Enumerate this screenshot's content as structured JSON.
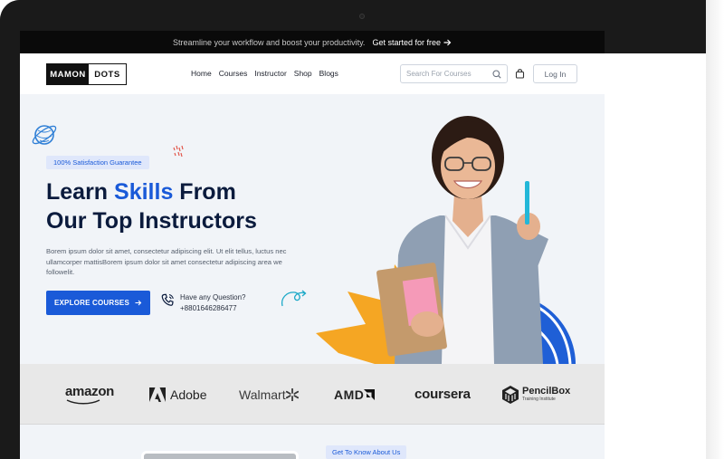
{
  "announcement": {
    "text": "Streamline your workflow and boost your productivity.",
    "cta_label": "Get started for free"
  },
  "nav": {
    "logo_part1": "MAMON",
    "logo_part2": "DOTS",
    "links": [
      "Home",
      "Courses",
      "Instructor",
      "Shop",
      "Blogs"
    ],
    "search_placeholder": "Search For Courses",
    "login_label": "Log In"
  },
  "hero": {
    "badge": "100% Satisfaction Guarantee",
    "headline_pre": "Learn ",
    "headline_highlight": "Skills",
    "headline_mid": " From",
    "headline_line2": "Our Top Instructors",
    "description": "Borem ipsum dolor sit amet, consectetur adipiscing elit. Ut elit tellus, luctus nec ullamcorper mattisBorem ipsum dolor sit amet consectetur adipiscing area we followelit.",
    "cta_label": "EXPLORE COURSES",
    "question_label": "Have any Question?",
    "phone": "+8801646286477"
  },
  "brands": {
    "amazon": "amazon",
    "adobe": "Adobe",
    "walmart": "Walmart",
    "amd": "AMD",
    "coursera": "coursera",
    "pencilbox": "PencilBox",
    "pencilbox_sub": "Training Institute"
  },
  "about": {
    "badge": "Get To Know About Us"
  },
  "colors": {
    "accent": "#1a5ad8",
    "navy": "#0b1b3d",
    "burst": "#f5a623",
    "swirl": "#1f5fd6",
    "page_bg": "#f1f4f8",
    "brand_strip": "#e8e8e8"
  }
}
